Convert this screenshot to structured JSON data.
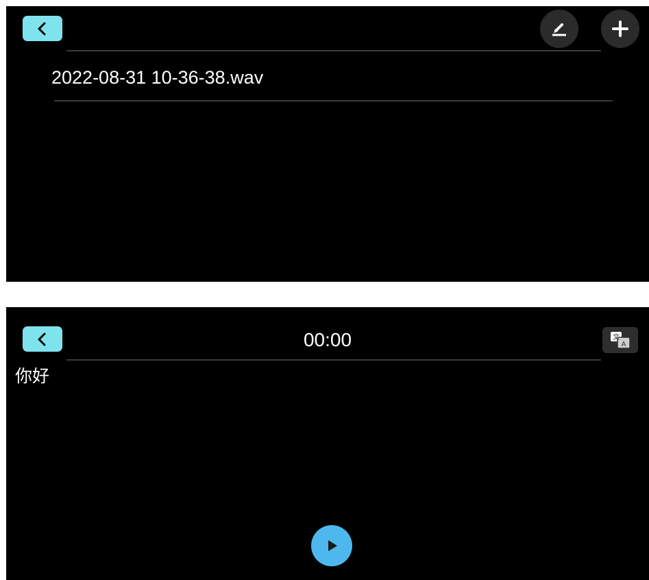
{
  "list_screen": {
    "back_icon": "chevron-left-icon",
    "edit_icon": "pencil-icon",
    "add_icon": "plus-icon",
    "files": [
      {
        "name": "2022-08-31 10-36-38.wav"
      }
    ]
  },
  "player_screen": {
    "back_icon": "chevron-left-icon",
    "timer": "00:00",
    "translate_icon": "translate-icon",
    "transcript": "你好",
    "play_icon": "play-icon"
  },
  "colors": {
    "background": "#000000",
    "back_button": "#7fe3ee",
    "play_button": "#4db8ee",
    "icon_button": "#2b2b2b",
    "divider": "#3a3a3a",
    "text": "#ffffff"
  }
}
